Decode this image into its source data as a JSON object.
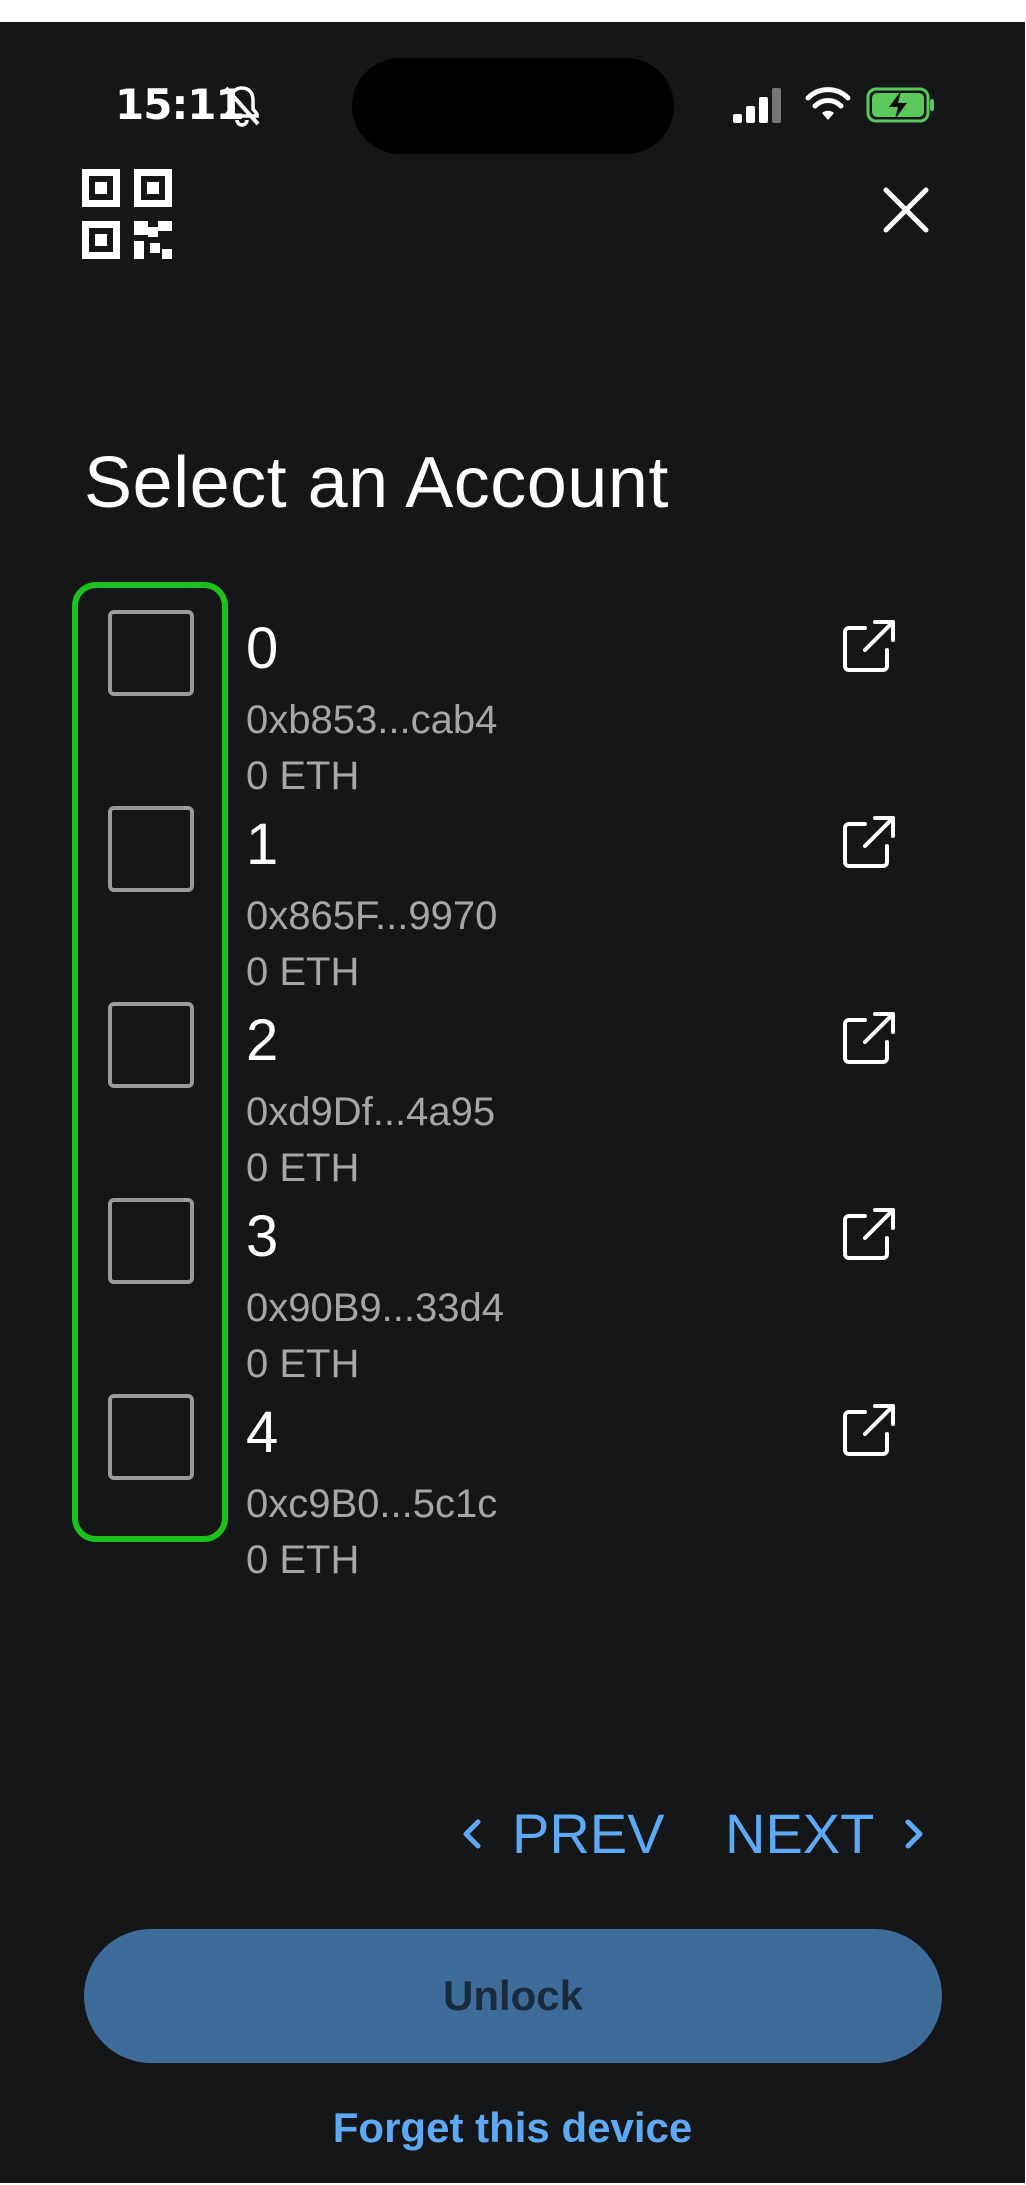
{
  "status_bar": {
    "time": "15:11",
    "icons": [
      "bell-slash-icon",
      "signal-icon",
      "wifi-icon",
      "battery-charging-icon"
    ]
  },
  "header": {
    "left_icon": "qr-code-icon",
    "right_icon": "close-icon"
  },
  "title": "Select an Account",
  "accounts": [
    {
      "index": "0",
      "address": "0xb853...cab4",
      "balance": "0 ETH",
      "checked": false
    },
    {
      "index": "1",
      "address": "0x865F...9970",
      "balance": "0 ETH",
      "checked": false
    },
    {
      "index": "2",
      "address": "0xd9Df...4a95",
      "balance": "0 ETH",
      "checked": false
    },
    {
      "index": "3",
      "address": "0x90B9...33d4",
      "balance": "0 ETH",
      "checked": false
    },
    {
      "index": "4",
      "address": "0xc9B0...5c1c",
      "balance": "0 ETH",
      "checked": false
    }
  ],
  "pagination": {
    "prev_label": "PREV",
    "next_label": "NEXT"
  },
  "actions": {
    "unlock_label": "Unlock",
    "forget_label": "Forget this device"
  },
  "colors": {
    "background": "#141618",
    "accent": "#5ea9f5",
    "unlock_bg": "#3e6c9a",
    "highlight": "#1cc11c"
  }
}
